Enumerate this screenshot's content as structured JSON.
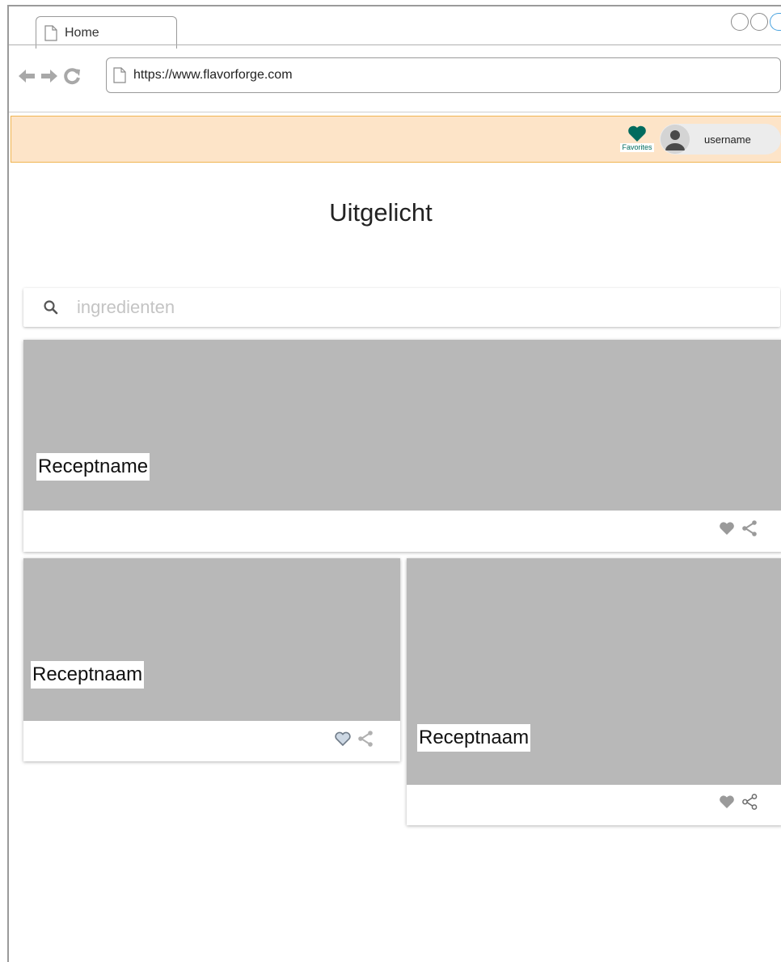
{
  "browser": {
    "tab_title": "Home",
    "url": "https://www.flavorforge.com"
  },
  "header": {
    "favorites_label": "Favorites",
    "username": "username",
    "accent_color": "#006b5e",
    "bar_color": "#fde4c8"
  },
  "page": {
    "title": "Uitgelicht"
  },
  "search": {
    "placeholder": "ingredienten",
    "value": ""
  },
  "recipes": [
    {
      "name": "Receptname",
      "favorited": false,
      "icons": [
        "heart-filled-icon",
        "share-icon"
      ]
    },
    {
      "name": "Receptnaam",
      "favorited": false,
      "icons": [
        "heart-outline-icon",
        "share-icon"
      ]
    },
    {
      "name": "Receptnaam",
      "favorited": false,
      "icons": [
        "heart-filled-icon",
        "share-icon"
      ]
    }
  ]
}
